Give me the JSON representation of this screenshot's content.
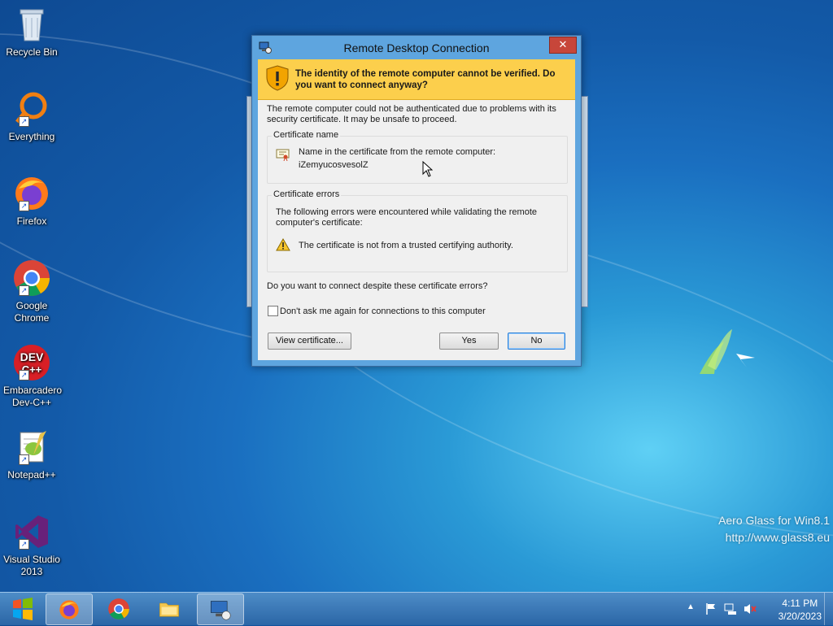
{
  "desktop": {
    "icons": [
      {
        "label": "Recycle Bin"
      },
      {
        "label": "Everything"
      },
      {
        "label": "Firefox"
      },
      {
        "label": "Google\nChrome"
      },
      {
        "label": "Embarcadero\nDev-C++"
      },
      {
        "label": "Notepad++"
      },
      {
        "label": "Visual Studio\n2013"
      }
    ],
    "watermark": {
      "line1": "Aero Glass for Win8.1",
      "line2": "http://www.glass8.eu"
    }
  },
  "dialog": {
    "title": "Remote Desktop Connection",
    "close_label": "✕",
    "banner": "The identity of the remote computer cannot be verified. Do you want to connect anyway?",
    "intro": "The remote computer could not be authenticated due to problems with its security certificate. It may be unsafe to proceed.",
    "cert_name": {
      "group_title": "Certificate name",
      "label": "Name in the certificate from the remote computer:",
      "value": "iZemyucosvesolZ"
    },
    "cert_errors": {
      "group_title": "Certificate errors",
      "intro": "The following errors were encountered while validating the remote computer's certificate:",
      "error": "The certificate is not from a trusted certifying authority."
    },
    "question": "Do you want to connect despite these certificate errors?",
    "checkbox_label": "Don't ask me again for connections to this computer",
    "checkbox_checked": false,
    "buttons": {
      "view_certificate": "View certificate...",
      "yes": "Yes",
      "no": "No"
    }
  },
  "taskbar": {
    "clock_time": "4:11 PM",
    "clock_date": "3/20/2023"
  },
  "colors": {
    "banner": "#fccf4c",
    "titlebar": "#5ea5df",
    "close": "#c7463a",
    "taskbar": "#3a78b8"
  }
}
